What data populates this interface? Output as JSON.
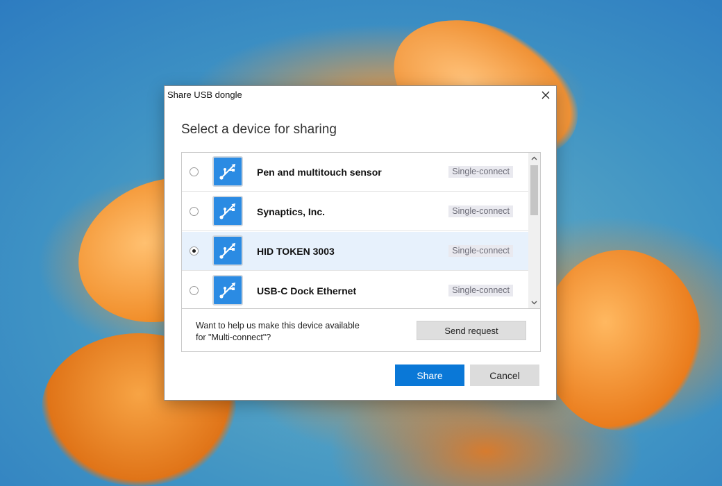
{
  "dialog": {
    "title": "Share USB dongle",
    "heading": "Select a device for sharing"
  },
  "devices": [
    {
      "name": "Pen and multitouch sensor",
      "badge": "Single-connect",
      "selected": false
    },
    {
      "name": "Synaptics, Inc.",
      "badge": "Single-connect",
      "selected": false
    },
    {
      "name": "HID TOKEN 3003",
      "badge": "Single-connect",
      "selected": true
    },
    {
      "name": "USB-C Dock Ethernet",
      "badge": "Single-connect",
      "selected": false
    }
  ],
  "request": {
    "text": "Want to help us make this device available\nfor \"Multi-connect\"?",
    "button_label": "Send request"
  },
  "buttons": {
    "share_label": "Share",
    "cancel_label": "Cancel"
  },
  "colors": {
    "accent": "#0a78d7",
    "icon_bg": "#2b8be3",
    "selected_row": "#e7f1fc"
  },
  "icons": {
    "device": "usb-icon",
    "close": "close-icon"
  }
}
